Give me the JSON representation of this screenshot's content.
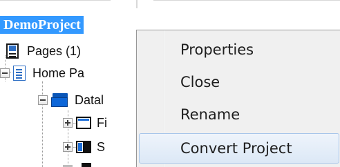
{
  "project": {
    "title": "DemoProject"
  },
  "tree": {
    "pages_label": "Pages (1)",
    "home_label": "Home Pa",
    "folder_label": "Datal",
    "child1_label": "Fi",
    "child2_label": "S"
  },
  "context_menu": {
    "items": [
      {
        "label": "Properties"
      },
      {
        "label": "Close"
      },
      {
        "label": "Rename"
      },
      {
        "label": "Convert Project"
      }
    ],
    "hovered_item": "Convert Project"
  },
  "icons": {
    "pages": "pages-icon",
    "home": "document-icon",
    "folder": "folder-icon",
    "child1": "frame-icon",
    "child2": "split-layout-icon"
  },
  "colors": {
    "selection": "#3399ff",
    "folder": "#0d66d8",
    "menu_background": "#f0f0f0",
    "menu_hover": "#dce8f6"
  }
}
